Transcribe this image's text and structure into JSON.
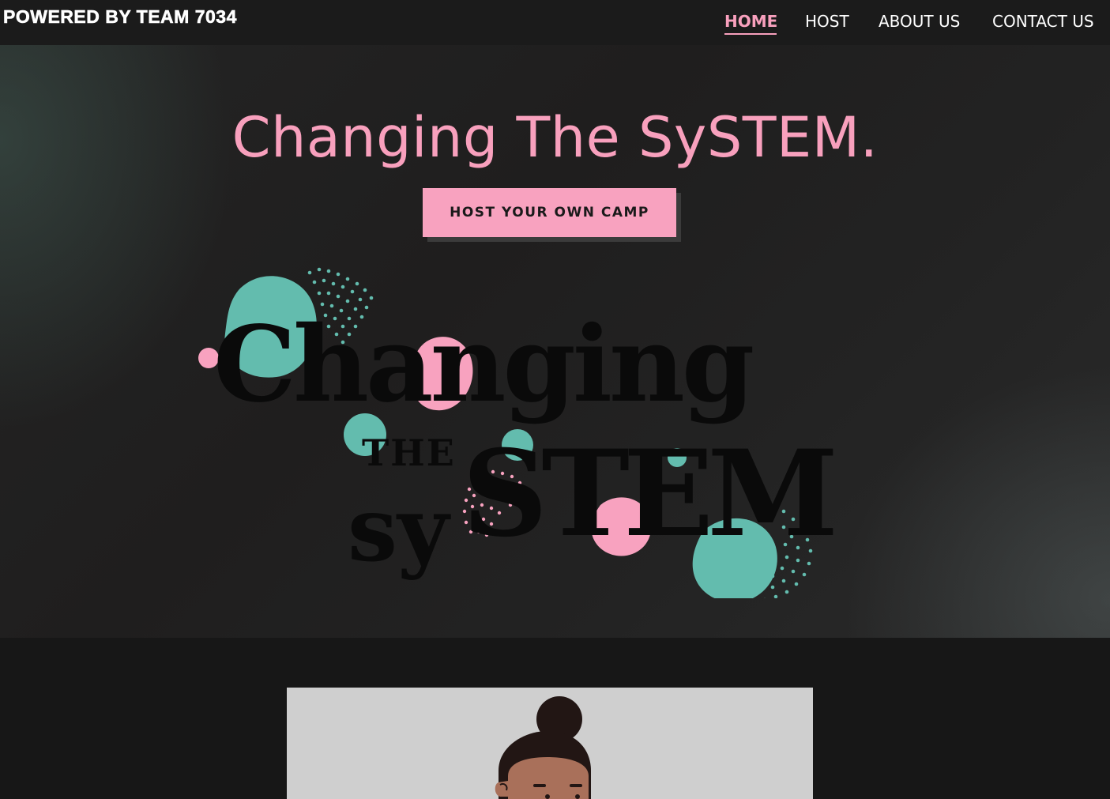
{
  "header": {
    "brand": "POWERED BY TEAM 7034",
    "nav": [
      {
        "label": "HOME",
        "active": true
      },
      {
        "label": "HOST",
        "active": false
      },
      {
        "label": "ABOUT US",
        "active": false
      },
      {
        "label": "CONTACT US",
        "active": false
      }
    ]
  },
  "hero": {
    "title": "Changing The SySTEM.",
    "cta_label": "HOST YOUR OWN CAMP",
    "logo": {
      "line1": "Changing",
      "line2": "THE",
      "line3_sy": "sy",
      "line3_stem": "STEM"
    }
  },
  "colors": {
    "accent_pink": "#f8a0bd",
    "teal": "#63bcae",
    "background": "#171717"
  },
  "illustration": {
    "icon": "person-with-hair-bun-illustration"
  }
}
